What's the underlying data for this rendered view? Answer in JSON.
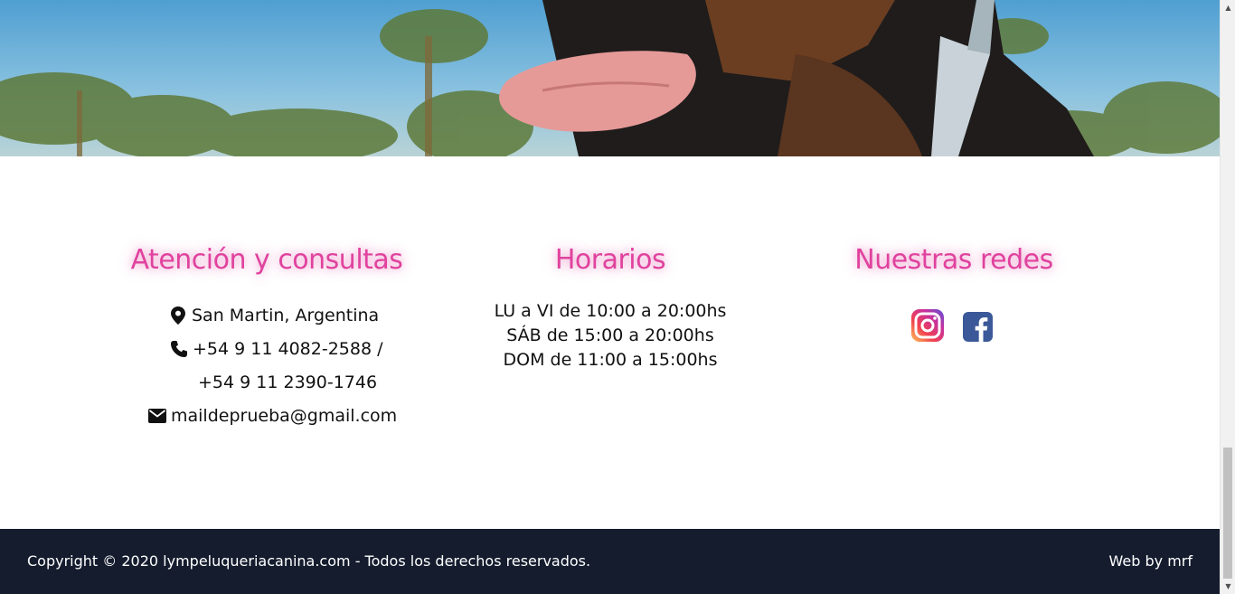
{
  "hero": {
    "image": "dog-photo-palm-trees"
  },
  "contact": {
    "title": "Atención y consultas",
    "location": "San Martin, Argentina",
    "phone1": "+54 9 11 4082-2588 /",
    "phone2": "+54 9 11 2390-1746",
    "email": "maildeprueba@gmail.com",
    "icons": [
      "map-pin-icon",
      "phone-icon",
      "envelope-icon"
    ]
  },
  "hours": {
    "title": "Horarios",
    "lines": [
      "LU a VI de 10:00 a 20:00hs",
      "SÁB de 15:00 a 20:00hs",
      "DOM de 11:00 a 15:00hs"
    ]
  },
  "social": {
    "title": "Nuestras redes",
    "icons": [
      "instagram-icon",
      "facebook-icon"
    ]
  },
  "footer": {
    "copyright": "Copyright © 2020 lympeluqueriacanina.com - Todos los derechos reservados.",
    "credit": "Web by mrf"
  },
  "colors": {
    "accent": "#e0429e",
    "footer_bg": "#141c2e",
    "facebook": "#3b5998"
  }
}
